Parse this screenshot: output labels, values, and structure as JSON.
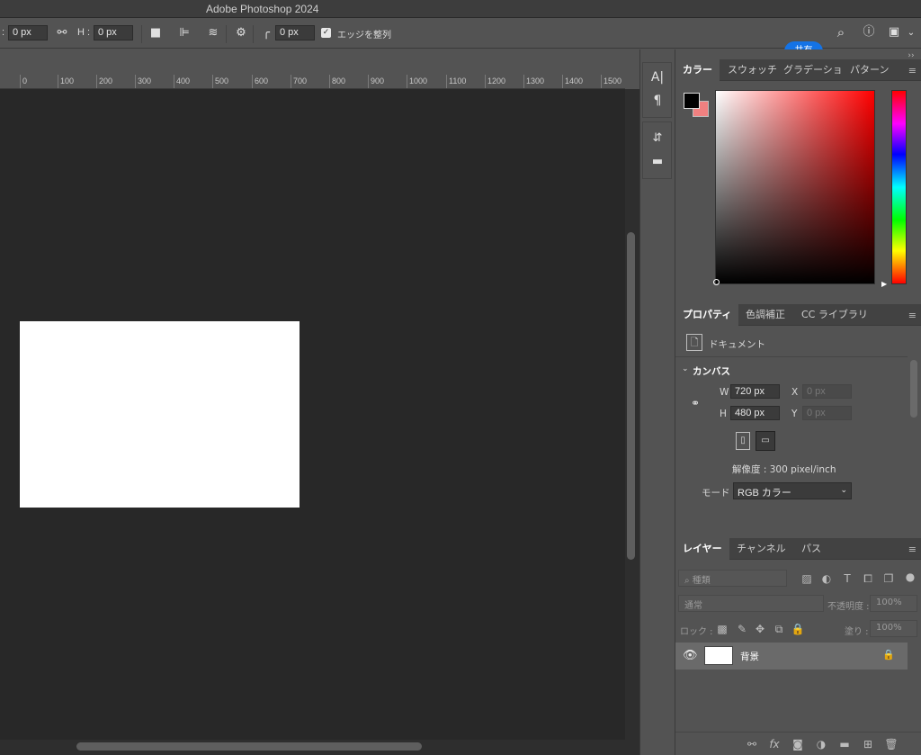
{
  "window": {
    "title": "Adobe Photoshop 2024"
  },
  "options_bar": {
    "w_label": ":",
    "w_value": "0 px",
    "h_label": "H :",
    "h_value": "0 px",
    "radius_value": "0 px",
    "align_edges_label": "エッジを整列",
    "share_button": "共有"
  },
  "ruler": {
    "labels": [
      "0",
      "100",
      "200",
      "300",
      "400",
      "500",
      "600",
      "700",
      "800",
      "900",
      "1000",
      "1100",
      "1200",
      "1300",
      "1400",
      "1500"
    ]
  },
  "color_panel": {
    "tabs": [
      "カラー",
      "スウォッチ",
      "グラデーショ",
      "パターン"
    ],
    "foreground": "#000000",
    "background": "#f08080"
  },
  "properties_panel": {
    "tabs": [
      "プロパティ",
      "色調補正",
      "CC ライブラリ"
    ],
    "doc_label": "ドキュメント",
    "section_title": "カンバス",
    "w_label": "W",
    "w_value": "720 px",
    "h_label": "H",
    "h_value": "480 px",
    "x_label": "X",
    "x_value": "0 px",
    "y_label": "Y",
    "y_value": "0 px",
    "resolution": "解像度 : 300 pixel/inch",
    "mode_label": "モード",
    "mode_value": "RGB カラー"
  },
  "layers_panel": {
    "tabs": [
      "レイヤー",
      "チャンネル",
      "パス"
    ],
    "filter_placeholder": "種類",
    "blend_mode": "通常",
    "opacity_label": "不透明度 :",
    "opacity_value": "100%",
    "lock_label": "ロック :",
    "fill_label": "塗り :",
    "fill_value": "100%",
    "layers": [
      {
        "name": "背景"
      }
    ]
  }
}
